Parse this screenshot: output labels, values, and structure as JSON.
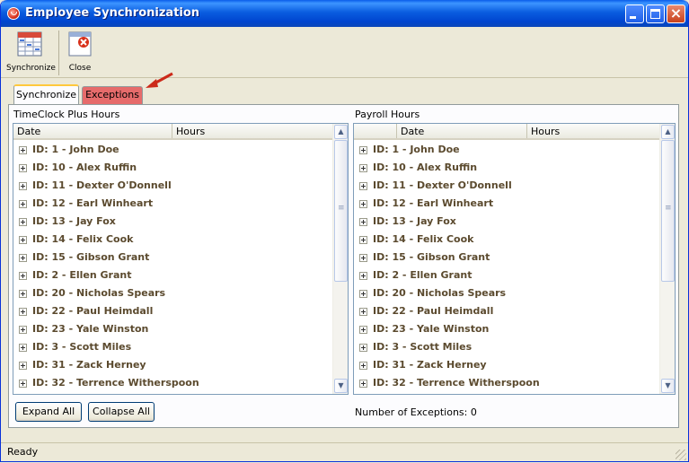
{
  "window": {
    "title": "Employee Synchronization"
  },
  "toolbar": {
    "synchronize_label": "Synchronize",
    "close_label": "Close"
  },
  "tabs": [
    {
      "label": "Synchronize"
    },
    {
      "label": "Exceptions"
    }
  ],
  "left_panel": {
    "title": "TimeClock Plus Hours",
    "columns": [
      "Date",
      "Hours"
    ],
    "rows": [
      "ID: 1 - John Doe",
      "ID: 10 - Alex Ruffin",
      "ID: 11 - Dexter O'Donnell",
      "ID: 12 - Earl Winheart",
      "ID: 13 - Jay Fox",
      "ID: 14 - Felix Cook",
      "ID: 15 - Gibson Grant",
      "ID: 2 - Ellen Grant",
      "ID: 20 - Nicholas Spears",
      "ID: 22 - Paul Heimdall",
      "ID: 23 - Yale Winston",
      "ID: 3 - Scott Miles",
      "ID: 31 - Zack Herney",
      "ID: 32 - Terrence Witherspoon"
    ]
  },
  "right_panel": {
    "title": "Payroll Hours",
    "columns": [
      "",
      "Date",
      "Hours"
    ],
    "rows": [
      "ID: 1 - John Doe",
      "ID: 10 - Alex Ruffin",
      "ID: 11 - Dexter O'Donnell",
      "ID: 12 - Earl Winheart",
      "ID: 13 - Jay Fox",
      "ID: 14 - Felix Cook",
      "ID: 15 - Gibson Grant",
      "ID: 2 - Ellen Grant",
      "ID: 20 - Nicholas Spears",
      "ID: 22 - Paul Heimdall",
      "ID: 23 - Yale Winston",
      "ID: 3 - Scott Miles",
      "ID: 31 - Zack Herney",
      "ID: 32 - Terrence Witherspoon"
    ]
  },
  "buttons": {
    "expand_all": "Expand All",
    "collapse_all": "Collapse All"
  },
  "exceptions_text": "Number of Exceptions: 0",
  "status": "Ready",
  "colors": {
    "exceptions_tab": "#e66b6b",
    "row_text": "#5b4a2e",
    "arrow": "#cc2a1a"
  }
}
